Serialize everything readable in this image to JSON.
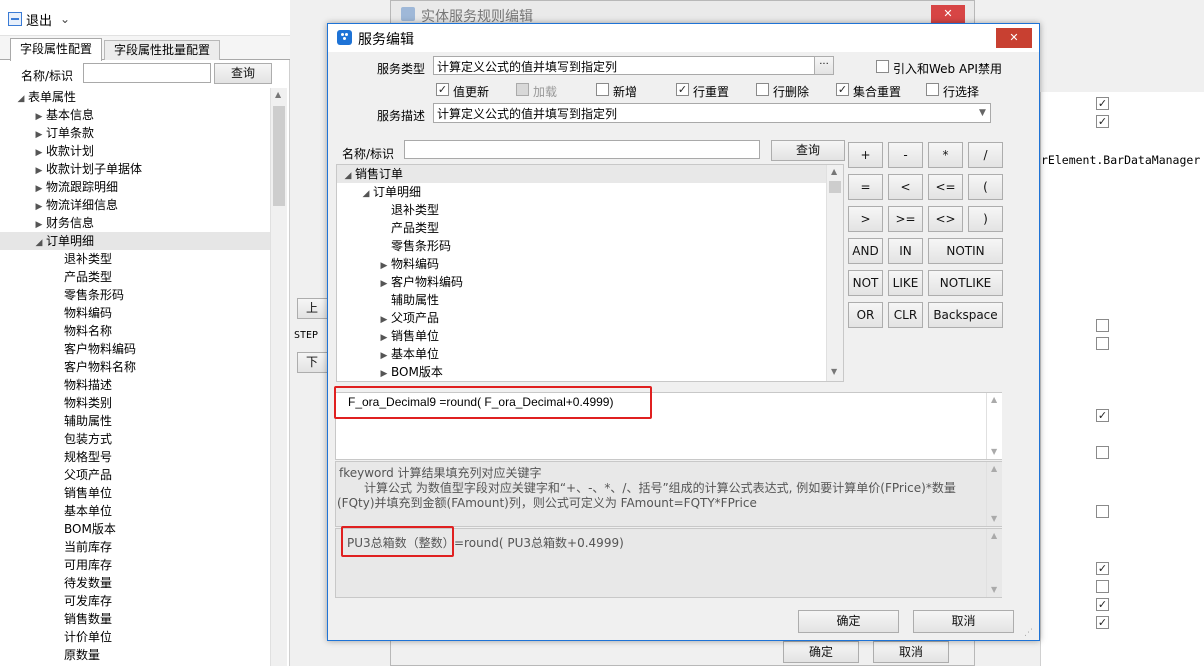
{
  "toolbar": {
    "exit_label": "退出",
    "menu_arrow": "⌄"
  },
  "left": {
    "tabs": [
      "字段属性配置",
      "字段属性批量配置"
    ],
    "search_label": "名称/标识",
    "search_value": "",
    "search_button": "查询",
    "tree": [
      {
        "label": "表单属性",
        "level": 0,
        "expander": "◢"
      },
      {
        "label": "基本信息",
        "level": 1,
        "expander": "▶"
      },
      {
        "label": "订单条款",
        "level": 1,
        "expander": "▶"
      },
      {
        "label": "收款计划",
        "level": 1,
        "expander": "▶"
      },
      {
        "label": "收款计划子单据体",
        "level": 1,
        "expander": "▶"
      },
      {
        "label": "物流跟踪明细",
        "level": 1,
        "expander": "▶"
      },
      {
        "label": "物流详细信息",
        "level": 1,
        "expander": "▶"
      },
      {
        "label": "财务信息",
        "level": 1,
        "expander": "▶"
      },
      {
        "label": "订单明细",
        "level": 1,
        "expander": "◢"
      },
      {
        "label": "退补类型",
        "level": 2,
        "expander": ""
      },
      {
        "label": "产品类型",
        "level": 2,
        "expander": ""
      },
      {
        "label": "零售条形码",
        "level": 2,
        "expander": ""
      },
      {
        "label": "物料编码",
        "level": 2,
        "expander": ""
      },
      {
        "label": "物料名称",
        "level": 2,
        "expander": ""
      },
      {
        "label": "客户物料编码",
        "level": 2,
        "expander": ""
      },
      {
        "label": "客户物料名称",
        "level": 2,
        "expander": ""
      },
      {
        "label": "物料描述",
        "level": 2,
        "expander": ""
      },
      {
        "label": "物料类别",
        "level": 2,
        "expander": ""
      },
      {
        "label": "辅助属性",
        "level": 2,
        "expander": ""
      },
      {
        "label": "包装方式",
        "level": 2,
        "expander": ""
      },
      {
        "label": "规格型号",
        "level": 2,
        "expander": ""
      },
      {
        "label": "父项产品",
        "level": 2,
        "expander": ""
      },
      {
        "label": "销售单位",
        "level": 2,
        "expander": ""
      },
      {
        "label": "基本单位",
        "level": 2,
        "expander": ""
      },
      {
        "label": "BOM版本",
        "level": 2,
        "expander": ""
      },
      {
        "label": "当前库存",
        "level": 2,
        "expander": ""
      },
      {
        "label": "可用库存",
        "level": 2,
        "expander": ""
      },
      {
        "label": "待发数量",
        "level": 2,
        "expander": ""
      },
      {
        "label": "可发库存",
        "level": 2,
        "expander": ""
      },
      {
        "label": "销售数量",
        "level": 2,
        "expander": ""
      },
      {
        "label": "计价单位",
        "level": 2,
        "expander": ""
      },
      {
        "label": "原数量",
        "level": 2,
        "expander": ""
      }
    ]
  },
  "middle": {
    "up_label": "上移",
    "step_label": "STEP",
    "down_label": "下移"
  },
  "back_window": {
    "title": "实体服务规则编辑",
    "right_text": "rElement.BarDataManager",
    "ok_label": "确定",
    "cancel_label": "取消",
    "checks": [
      {
        "checked": true
      },
      {
        "checked": true
      },
      {
        "checked": false
      },
      {
        "checked": false
      },
      {
        "checked": true
      },
      {
        "checked": false
      },
      {
        "checked": false
      },
      {
        "checked": true
      },
      {
        "checked": false
      },
      {
        "checked": true
      },
      {
        "checked": true
      }
    ]
  },
  "dialog": {
    "title": "服务编辑",
    "close_glyph": "✕",
    "service_type_label": "服务类型",
    "service_type_value": "计算定义公式的值并填写到指定列",
    "browse_glyph": "···",
    "webapi_label": "引入和Web API禁用",
    "webapi_checked": false,
    "options": [
      {
        "label": "值更新",
        "checked": true,
        "disabled": false
      },
      {
        "label": "加载",
        "checked": false,
        "disabled": true
      },
      {
        "label": "新增",
        "checked": false,
        "disabled": false
      },
      {
        "label": "行重置",
        "checked": true,
        "disabled": false
      },
      {
        "label": "行删除",
        "checked": false,
        "disabled": false
      },
      {
        "label": "集合重置",
        "checked": true,
        "disabled": false
      },
      {
        "label": "行选择",
        "checked": false,
        "disabled": false
      }
    ],
    "desc_label": "服务描述",
    "desc_value": "计算定义公式的值并填写到指定列",
    "desc_arrow": "▼",
    "search_label": "名称/标识",
    "search_value": "",
    "search_button": "查询",
    "tree": [
      {
        "label": "销售订单",
        "level": 0,
        "expander": "◢"
      },
      {
        "label": "订单明细",
        "level": 1,
        "expander": "◢"
      },
      {
        "label": "退补类型",
        "level": 2,
        "expander": ""
      },
      {
        "label": "产品类型",
        "level": 2,
        "expander": ""
      },
      {
        "label": "零售条形码",
        "level": 2,
        "expander": ""
      },
      {
        "label": "物料编码",
        "level": 2,
        "expander": "▶"
      },
      {
        "label": "客户物料编码",
        "level": 2,
        "expander": "▶"
      },
      {
        "label": "辅助属性",
        "level": 2,
        "expander": ""
      },
      {
        "label": "父项产品",
        "level": 2,
        "expander": "▶"
      },
      {
        "label": "销售单位",
        "level": 2,
        "expander": "▶"
      },
      {
        "label": "基本单位",
        "level": 2,
        "expander": "▶"
      },
      {
        "label": "BOM版本",
        "level": 2,
        "expander": "▶"
      }
    ],
    "operators": [
      [
        "+",
        "-",
        "*",
        "/"
      ],
      [
        "=",
        "<",
        "<=",
        "("
      ],
      [
        ">",
        ">=",
        "<>",
        ")"
      ],
      [
        "AND",
        "IN",
        "NOTIN"
      ],
      [
        "NOT",
        "LIKE",
        "NOTLIKE"
      ],
      [
        "OR",
        "CLR",
        "Backspace"
      ]
    ],
    "formula": "F_ora_Decimal9 =round( F_ora_Decimal+0.4999)",
    "help_line1": "fkeyword  计算结果填充列对应关键字",
    "help_line2": "计算公式     为数值型字段对应关键字和“+、-、*、/、括号”组成的计算公式表达式, 例如要计算单价(FPrice)*数量",
    "help_line3": "(FQty)并填充到金额(FAmount)列，则公式可定义为 FAmount=FQTY*FPrice",
    "preview_field": "PU3总箱数（整数）",
    "preview_rest": " =round( PU3总箱数+0.4999)",
    "ok_label": "确定",
    "cancel_label": "取消"
  },
  "colors": {
    "accent": "#1e73d6",
    "highlight_red": "#e02020"
  }
}
